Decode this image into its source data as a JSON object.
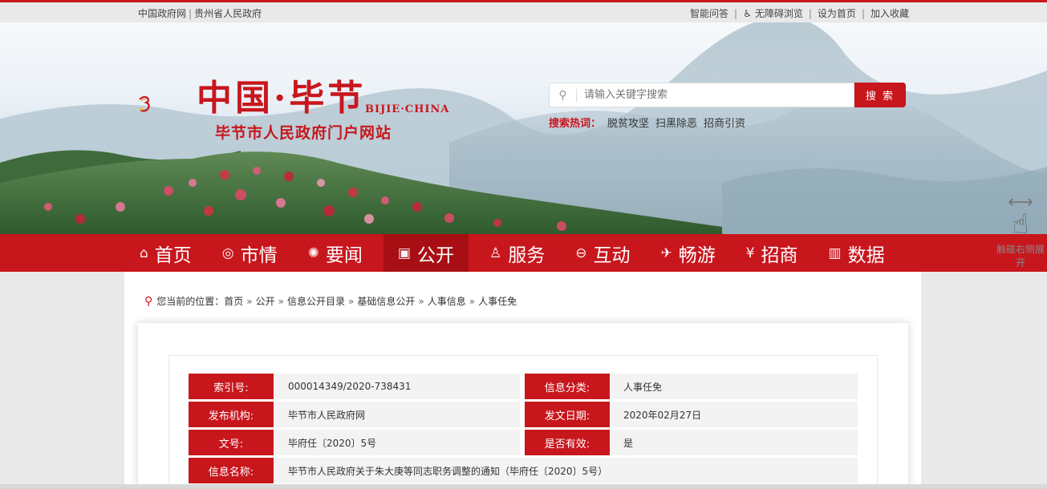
{
  "top": {
    "left_links": [
      "中国政府网",
      "贵州省人民政府"
    ],
    "right_links": [
      "智能问答",
      "无障碍浏览",
      "设为首页",
      "加入收藏"
    ]
  },
  "logo": {
    "title": "中国·毕节",
    "english": "BIJIE·CHINA",
    "subtitle": "毕节市人民政府门户网站"
  },
  "search": {
    "placeholder": "请输入关键字搜索",
    "button": "搜 索",
    "hot_label": "搜索热词：",
    "hot_words": [
      "脱贫攻坚",
      "扫黑除恶",
      "招商引资"
    ]
  },
  "nav": [
    {
      "label": "首页",
      "icon": "home-icon",
      "glyph": "⌂"
    },
    {
      "label": "市情",
      "icon": "pulse-icon",
      "glyph": "◎"
    },
    {
      "label": "要闻",
      "icon": "news-icon",
      "glyph": "✺"
    },
    {
      "label": "公开",
      "icon": "monitor-icon",
      "glyph": "▣",
      "active": true
    },
    {
      "label": "服务",
      "icon": "people-icon",
      "glyph": "♙"
    },
    {
      "label": "互动",
      "icon": "chat-icon",
      "glyph": "⊖"
    },
    {
      "label": "畅游",
      "icon": "plane-icon",
      "glyph": "✈"
    },
    {
      "label": "招商",
      "icon": "yen-icon",
      "glyph": "¥"
    },
    {
      "label": "数据",
      "icon": "bar-chart-icon",
      "glyph": "▥"
    }
  ],
  "side_hint": {
    "text": "触碰右侧展开"
  },
  "breadcrumb": {
    "label": "您当前的位置：",
    "items": [
      "首页",
      "公开",
      "信息公开目录",
      "基础信息公开",
      "人事信息",
      "人事任免"
    ]
  },
  "info": {
    "index_key": "索引号:",
    "index_val": "000014349/2020-738431",
    "category_key": "信息分类:",
    "category_val": "人事任免",
    "publisher_key": "发布机构:",
    "publisher_val": "毕节市人民政府网",
    "date_key": "发文日期:",
    "date_val": "2020年02月27日",
    "docno_key": "文号:",
    "docno_val": "毕府任〔2020〕5号",
    "valid_key": "是否有效:",
    "valid_val": "是",
    "name_key": "信息名称:",
    "name_val": "毕节市人民政府关于朱大庚等同志职务调整的通知（毕府任〔2020〕5号）"
  },
  "colors": {
    "brand_red": "#c8161d",
    "nav_active": "#a80f14"
  }
}
